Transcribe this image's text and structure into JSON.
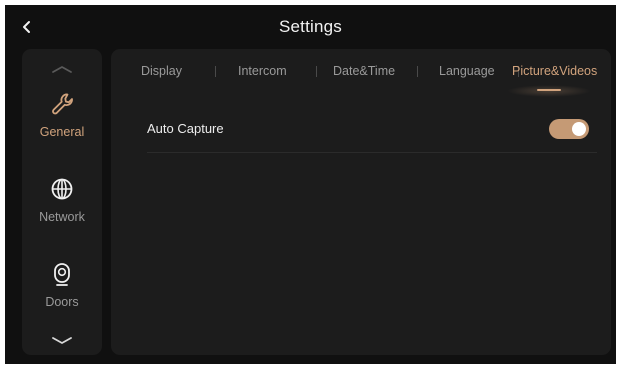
{
  "header": {
    "title": "Settings",
    "back_icon": "chevron-left-icon"
  },
  "sidebar": {
    "scroll_up_icon": "chevron-up-icon",
    "scroll_down_icon": "chevron-down-icon",
    "items": [
      {
        "label": "General",
        "icon": "wrench-icon",
        "active": true
      },
      {
        "label": "Network",
        "icon": "globe-icon",
        "active": false
      },
      {
        "label": "Doors",
        "icon": "camera-icon",
        "active": false
      }
    ]
  },
  "tabs": [
    {
      "label": "Display",
      "active": false
    },
    {
      "label": "Intercom",
      "active": false
    },
    {
      "label": "Date&Time",
      "active": false
    },
    {
      "label": "Language",
      "active": false
    },
    {
      "label": "Picture&Videos",
      "active": true
    }
  ],
  "settings": {
    "auto_capture": {
      "label": "Auto Capture",
      "enabled": true
    }
  },
  "colors": {
    "background": "#101010",
    "panel": "#1c1c1c",
    "accent": "#d1a37d",
    "toggle_on": "#c59a75",
    "text_primary": "#f2f2f2",
    "text_muted": "#9a9a9a"
  }
}
